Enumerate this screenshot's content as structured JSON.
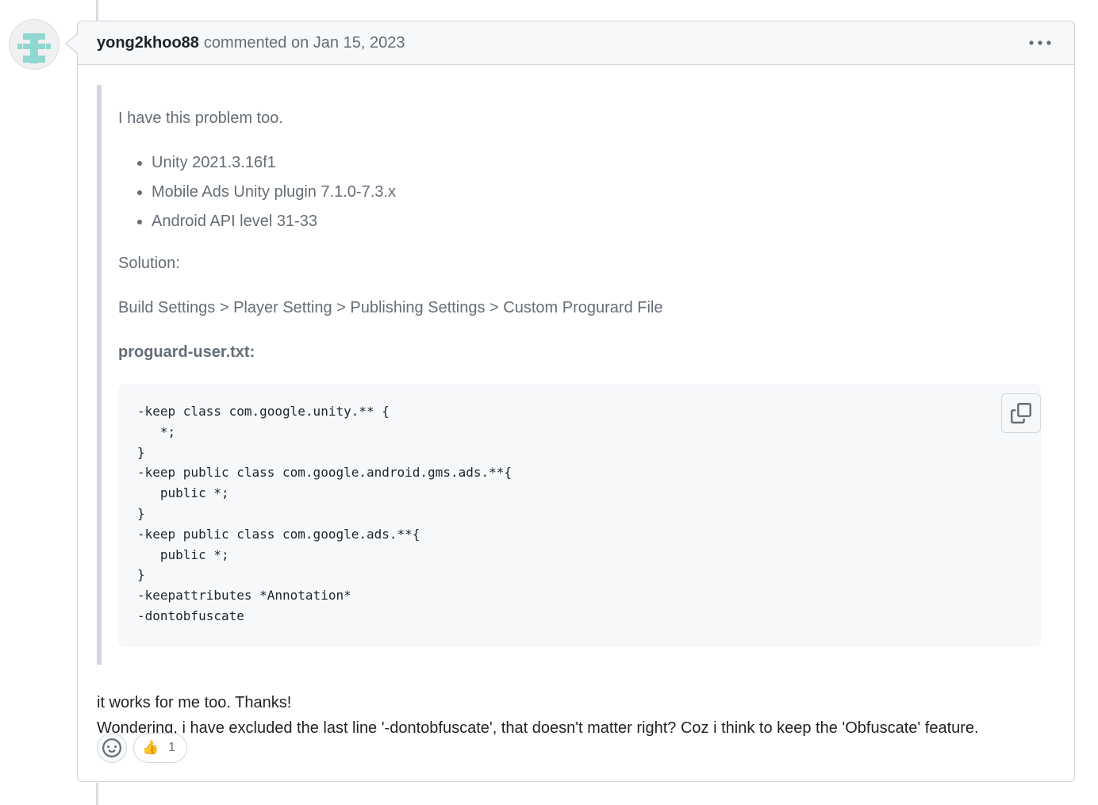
{
  "comment": {
    "author": "yong2khoo88",
    "action": "commented on",
    "date": "Jan 15, 2023",
    "menu_icon": "kebab-horizontal-icon"
  },
  "quote": {
    "intro": "I have this problem too.",
    "list": [
      "Unity 2021.3.16f1",
      "Mobile Ads Unity plugin 7.1.0-7.3.x",
      "Android API level 31-33"
    ],
    "solution_label": "Solution:",
    "path": "Build Settings > Player Setting > Publishing Settings > Custom Progurard File",
    "filename": "proguard-user.txt:",
    "code": "-keep class com.google.unity.** {\n   *;\n}\n-keep public class com.google.android.gms.ads.**{\n   public *;\n}\n-keep public class com.google.ads.**{\n   public *;\n}\n-keepattributes *Annotation*\n-dontobfuscate",
    "copy_icon": "copy-icon"
  },
  "reply": {
    "line1": "it works for me too. Thanks!",
    "line2": "Wondering, i have excluded the last line '-dontobfuscate', that doesn't matter right? Coz i think to keep the 'Obfuscate' feature."
  },
  "reactions": {
    "add_icon": "smiley-icon",
    "items": [
      {
        "emoji": "👍",
        "count": "1"
      }
    ]
  },
  "colors": {
    "border": "#d0d7de",
    "header_bg": "#f6f8fa",
    "muted_text": "#656d76",
    "text": "#1f2328",
    "avatar_pattern": "#8fd8d1"
  }
}
